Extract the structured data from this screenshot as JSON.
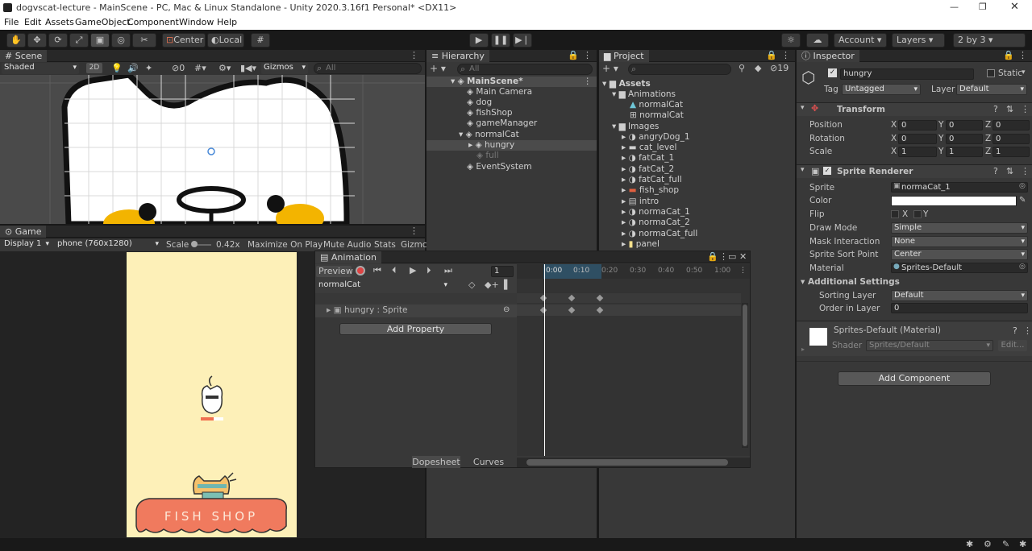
{
  "window": {
    "title": "dogvscat-lecture - MainScene - PC, Mac & Linux Standalone - Unity 2020.3.16f1 Personal* <DX11>"
  },
  "menu": [
    "File",
    "Edit",
    "Assets",
    "GameObject",
    "Component",
    "Window",
    "Help"
  ],
  "toolbar": {
    "pivot": "Center",
    "space": "Local",
    "account": "Account",
    "layers": "Layers",
    "layout": "2 by 3"
  },
  "scene": {
    "tab": "Scene",
    "shading": "Shaded",
    "mode_2d": "2D",
    "gizmos": "Gizmos",
    "search_placeholder": "All",
    "hidden_count": "0"
  },
  "game": {
    "tab": "Game",
    "display": "Display 1",
    "resolution": "phone (760x1280)",
    "scale_label": "Scale",
    "scale_value": "0.42x",
    "maximize": "Maximize On Play",
    "mute": "Mute Audio",
    "stats": "Stats",
    "gizmos": "Gizmc",
    "shop_sign": "FISH SHOP"
  },
  "hierarchy": {
    "tab": "Hierarchy",
    "search_placeholder": "All",
    "items": [
      {
        "label": "MainScene*",
        "indent": 0
      },
      {
        "label": "Main Camera",
        "indent": 1
      },
      {
        "label": "dog",
        "indent": 1
      },
      {
        "label": "fishShop",
        "indent": 1
      },
      {
        "label": "gameManager",
        "indent": 1
      },
      {
        "label": "normalCat",
        "indent": 1
      },
      {
        "label": "hungry",
        "indent": 2
      },
      {
        "label": "full",
        "indent": 2
      },
      {
        "label": "EventSystem",
        "indent": 1
      }
    ]
  },
  "project": {
    "tab": "Project",
    "badge": "19",
    "tree": [
      {
        "label": "Assets",
        "indent": 0
      },
      {
        "label": "Animations",
        "indent": 1
      },
      {
        "label": "normalCat",
        "indent": 2
      },
      {
        "label": "normalCat",
        "indent": 2
      },
      {
        "label": "Images",
        "indent": 1
      },
      {
        "label": "angryDog_1",
        "indent": 2
      },
      {
        "label": "cat_level",
        "indent": 2
      },
      {
        "label": "fatCat_1",
        "indent": 2
      },
      {
        "label": "fatCat_2",
        "indent": 2
      },
      {
        "label": "fatCat_full",
        "indent": 2
      },
      {
        "label": "fish_shop",
        "indent": 2
      },
      {
        "label": "intro",
        "indent": 2
      },
      {
        "label": "normaCat_1",
        "indent": 2
      },
      {
        "label": "normaCat_2",
        "indent": 2
      },
      {
        "label": "normaCat_full",
        "indent": 2
      },
      {
        "label": "panel",
        "indent": 2
      }
    ]
  },
  "animation": {
    "tab": "Animation",
    "preview": "Preview",
    "frame": "1",
    "clip": "normalCat",
    "property": "hungry : Sprite",
    "add_property": "Add Property",
    "dopesheet": "Dopesheet",
    "curves": "Curves",
    "ticks": [
      "0:00",
      "0:10",
      "0:20",
      "0:30",
      "0:40",
      "0:50",
      "1:00"
    ]
  },
  "inspector": {
    "tab": "Inspector",
    "object_name": "hungry",
    "static": "Static",
    "tag_label": "Tag",
    "tag": "Untagged",
    "layer_label": "Layer",
    "layer": "Default",
    "transform": {
      "title": "Transform",
      "rows": [
        {
          "label": "Position",
          "x": "0",
          "y": "0",
          "z": "0"
        },
        {
          "label": "Rotation",
          "x": "0",
          "y": "0",
          "z": "0"
        },
        {
          "label": "Scale",
          "x": "1",
          "y": "1",
          "z": "1"
        }
      ]
    },
    "sprite_renderer": {
      "title": "Sprite Renderer",
      "sprite_label": "Sprite",
      "sprite": "normaCat_1",
      "color_label": "Color",
      "flip_label": "Flip",
      "flip_x": "X",
      "flip_y": "Y",
      "draw_mode_label": "Draw Mode",
      "draw_mode": "Simple",
      "mask_label": "Mask Interaction",
      "mask": "None",
      "sort_point_label": "Sprite Sort Point",
      "sort_point": "Center",
      "material_label": "Material",
      "material": "Sprites-Default",
      "additional": "Additional Settings",
      "sorting_layer_label": "Sorting Layer",
      "sorting_layer": "Default",
      "order_label": "Order in Layer",
      "order": "0"
    },
    "material": {
      "title": "Sprites-Default (Material)",
      "shader_label": "Shader",
      "shader": "Sprites/Default",
      "edit": "Edit..."
    },
    "add_component": "Add Component"
  }
}
